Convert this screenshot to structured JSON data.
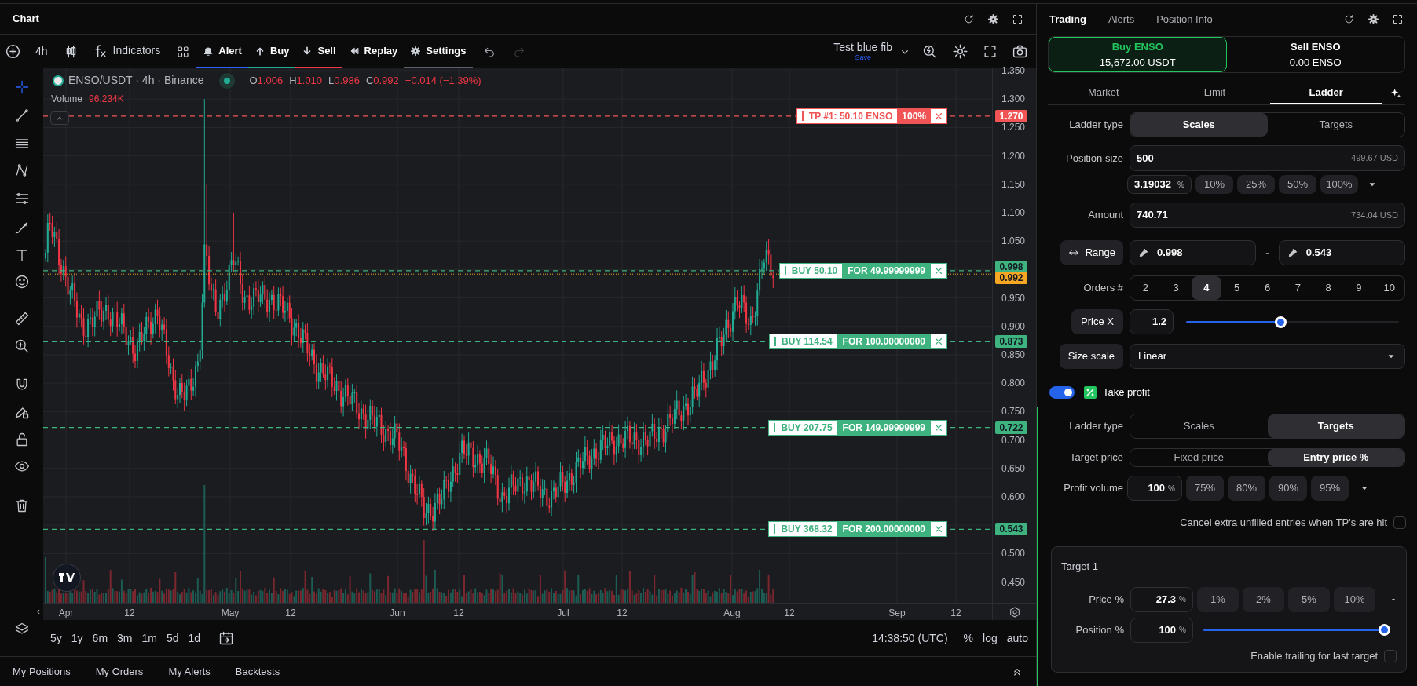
{
  "chart_window": {
    "title": "Chart"
  },
  "chart_toolbar": {
    "interval": "4h",
    "items": [
      {
        "kind": "indicators",
        "label": "Indicators"
      },
      {
        "kind": "alert",
        "label": "Alert",
        "color": "#2962ff"
      },
      {
        "kind": "buy",
        "label": "Buy",
        "color": "#22ab94"
      },
      {
        "kind": "sell",
        "label": "Sell",
        "color": "#f23645"
      },
      {
        "kind": "replay",
        "label": "Replay"
      },
      {
        "kind": "settings",
        "label": "Settings",
        "color": "#5d606b"
      }
    ],
    "history": [
      {
        "kind": "undo",
        "disabled": false
      },
      {
        "kind": "redo",
        "disabled": true
      }
    ],
    "layout": {
      "name": "Test blue fib",
      "action": "Save"
    }
  },
  "drawing_tools": [
    {
      "kind": "crosshair",
      "selected": true
    },
    {
      "kind": "trendline",
      "selected": false
    },
    {
      "kind": "lines",
      "selected": false
    },
    {
      "kind": "pattern",
      "selected": false
    },
    {
      "kind": "fibonacci",
      "selected": false
    },
    {
      "kind": "brush",
      "selected": false
    },
    {
      "kind": "text",
      "selected": false
    },
    {
      "kind": "emoji",
      "selected": false
    },
    {
      "kind": "ruler",
      "selected": false
    },
    {
      "kind": "zoom",
      "selected": false
    },
    {
      "kind": "magnet",
      "selected": false
    },
    {
      "kind": "lockdraw",
      "selected": false
    },
    {
      "kind": "lock",
      "selected": false
    },
    {
      "kind": "eye",
      "selected": false
    },
    {
      "kind": "trash",
      "selected": false
    }
  ],
  "legend": {
    "symbol": "ENSO/USDT · 4h · Binance",
    "ohlc": [
      {
        "label": "O",
        "value": "1.006"
      },
      {
        "label": "H",
        "value": "1.010"
      },
      {
        "label": "L",
        "value": "0.986"
      },
      {
        "label": "C",
        "value": "0.992"
      }
    ],
    "change": "−0.014 (−1.39%)",
    "volume_label": "Volume",
    "volume_value": "96.234K"
  },
  "price_axis": {
    "ticks": [
      "1.350",
      "1.300",
      "1.250",
      "1.200",
      "1.150",
      "1.100",
      "1.050",
      "0.950",
      "0.900",
      "0.850",
      "0.800",
      "0.750",
      "0.700",
      "0.650",
      "0.600",
      "0.500",
      "0.450"
    ],
    "tags": [
      {
        "kind": "take_profit",
        "value": "1.270",
        "color": "#f05454"
      },
      {
        "kind": "order",
        "value": "0.998",
        "color": "#3fb37f"
      },
      {
        "kind": "last_price",
        "value": "0.992",
        "color": "#f5a623"
      },
      {
        "kind": "order",
        "value": "0.873",
        "color": "#3fb37f"
      },
      {
        "kind": "order",
        "value": "0.722",
        "color": "#3fb37f"
      },
      {
        "kind": "order",
        "value": "0.543",
        "color": "#3fb37f"
      }
    ]
  },
  "order_lines": [
    {
      "kind": "take_profit",
      "label": "TP #1: 50.10 ENSO",
      "amount": "100%"
    },
    {
      "kind": "buy",
      "label": "BUY 50.10",
      "amount": "FOR 49.99999999"
    },
    {
      "kind": "buy",
      "label": "BUY 114.54",
      "amount": "FOR 100.00000000"
    },
    {
      "kind": "buy",
      "label": "BUY 207.75",
      "amount": "FOR 149.99999999"
    },
    {
      "kind": "buy",
      "label": "BUY 368.32",
      "amount": "FOR 200.00000000"
    }
  ],
  "time_axis": {
    "scroll_glyph": "‹",
    "labels": [
      "Apr",
      "12",
      "May",
      "12",
      "Jun",
      "12",
      "Jul",
      "12",
      "Aug",
      "12",
      "Sep",
      "12"
    ]
  },
  "bottom_toolbar": {
    "ranges": [
      "5y",
      "1y",
      "6m",
      "3m",
      "1m",
      "5d",
      "1d"
    ],
    "clock": "14:38:50 (UTC)",
    "scale_options": [
      "%",
      "log",
      "auto"
    ]
  },
  "bottom_tabs": [
    "My Positions",
    "My Orders",
    "My Alerts",
    "Backtests"
  ],
  "trading_panel": {
    "tabs": [
      {
        "label": "Trading",
        "selected": true
      },
      {
        "label": "Alerts",
        "selected": false
      },
      {
        "label": "Position Info",
        "selected": false
      }
    ],
    "sides": [
      {
        "kind": "buy",
        "title": "Buy ENSO",
        "balance": "15,672.00 USDT",
        "selected": true
      },
      {
        "kind": "sell",
        "title": "Sell ENSO",
        "balance": "0.00 ENSO",
        "selected": false
      }
    ],
    "order_types": [
      {
        "label": "Market",
        "selected": false
      },
      {
        "label": "Limit",
        "selected": false
      },
      {
        "label": "Ladder",
        "selected": true
      }
    ],
    "ladder": {
      "ladder_type": {
        "label": "Ladder type",
        "options": [
          {
            "label": "Scales",
            "selected": true
          },
          {
            "label": "Targets",
            "selected": false
          }
        ]
      },
      "position_size": {
        "label": "Position size",
        "value": "500",
        "equivalent": "499.67 USD",
        "percent": "3.19032",
        "percent_unit": "%",
        "presets": [
          "10%",
          "25%",
          "50%",
          "100%"
        ]
      },
      "amount": {
        "label": "Amount",
        "value": "740.71",
        "equivalent": "734.04 USD"
      },
      "range": {
        "label": "Range",
        "from": "0.998",
        "separator": "-",
        "to": "0.543"
      },
      "orders": {
        "label": "Orders #",
        "options": [
          {
            "label": "2",
            "selected": false
          },
          {
            "label": "3",
            "selected": false
          },
          {
            "label": "4",
            "selected": true
          },
          {
            "label": "5",
            "selected": false
          },
          {
            "label": "6",
            "selected": false
          },
          {
            "label": "7",
            "selected": false
          },
          {
            "label": "8",
            "selected": false
          },
          {
            "label": "9",
            "selected": false
          },
          {
            "label": "10",
            "selected": false
          }
        ]
      },
      "price_x": {
        "label": "Price X",
        "value": "1.2",
        "level": 0.44
      },
      "size_scale": {
        "label": "Size scale",
        "value": "Linear"
      }
    },
    "take_profit": {
      "on": true,
      "label": "Take profit",
      "ladder_type": {
        "label": "Ladder type",
        "options": [
          {
            "label": "Scales",
            "selected": false
          },
          {
            "label": "Targets",
            "selected": true
          }
        ]
      },
      "target_price": {
        "label": "Target price",
        "options": [
          {
            "label": "Fixed price",
            "selected": false
          },
          {
            "label": "Entry price %",
            "selected": true
          }
        ]
      },
      "profit_volume": {
        "label": "Profit volume",
        "value": "100",
        "unit": "%",
        "presets": [
          "75%",
          "80%",
          "90%",
          "95%"
        ]
      },
      "cancel_entries": {
        "label": "Cancel extra unfilled entries when TP's are hit",
        "checked": false
      },
      "targets": [
        {
          "title": "Target 1",
          "price": {
            "label": "Price %",
            "value": "27.3",
            "unit": "%",
            "presets": [
              "1%",
              "2%",
              "5%",
              "10%"
            ]
          },
          "position": {
            "label": "Position %",
            "value": "100",
            "unit": "%",
            "level": 1
          },
          "trailing": {
            "label": "Enable trailing for last target",
            "checked": false
          }
        }
      ]
    }
  }
}
